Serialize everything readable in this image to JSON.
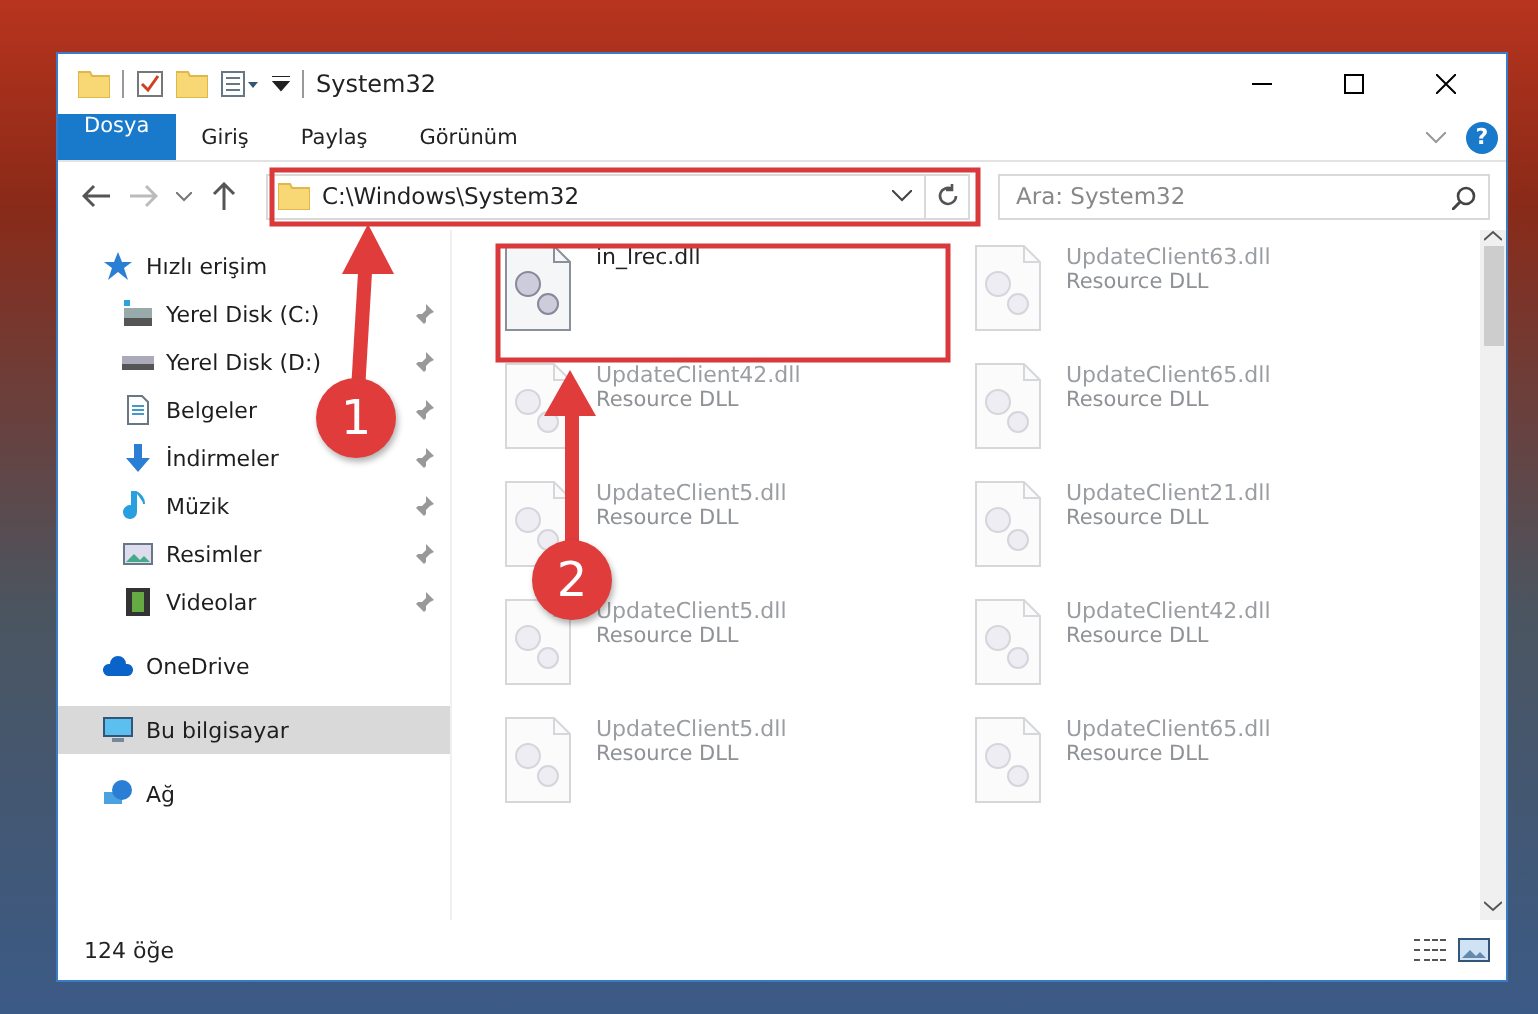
{
  "window": {
    "title": "System32"
  },
  "ribbon": {
    "tabs": [
      {
        "label": "Dosya",
        "kind": "file"
      },
      {
        "label": "Giriş",
        "kind": "tab"
      },
      {
        "label": "Paylaş",
        "kind": "tab"
      },
      {
        "label": "Görünüm",
        "kind": "tab"
      }
    ],
    "help": "?"
  },
  "address": {
    "path": "C:\\Windows\\System32"
  },
  "search": {
    "placeholder": "Ara: System32"
  },
  "nav": [
    {
      "label": "Hızlı erişim",
      "kind": "star",
      "selected": false,
      "children": [
        {
          "label": "Yerel Disk (C:)",
          "kind": "drive-c",
          "pinned": true,
          "selected": false
        },
        {
          "label": "Yerel Disk (D:)",
          "kind": "drive",
          "pinned": true,
          "selected": false
        },
        {
          "label": "Belgeler",
          "kind": "documents",
          "pinned": true,
          "selected": false
        },
        {
          "label": "İndirmeler",
          "kind": "downloads",
          "pinned": true,
          "selected": false
        },
        {
          "label": "Müzik",
          "kind": "music",
          "pinned": true,
          "selected": false
        },
        {
          "label": "Resimler",
          "kind": "pictures",
          "pinned": true,
          "selected": false
        },
        {
          "label": "Videolar",
          "kind": "videos",
          "pinned": true,
          "selected": false
        }
      ]
    },
    {
      "label": "OneDrive",
      "kind": "cloud",
      "selected": false
    },
    {
      "label": "Bu bilgisayar",
      "kind": "computer",
      "selected": true
    },
    {
      "label": "Ağ",
      "kind": "network",
      "selected": false
    }
  ],
  "files": [
    {
      "name": "in_lrec.dll",
      "faded": false
    },
    {
      "name": "UpdateClient63.dll",
      "type": "Resource DLL",
      "faded": true
    },
    {
      "name": "UpdateClient42.dll",
      "type": "Resource DLL",
      "faded": true
    },
    {
      "name": "UpdateClient65.dll",
      "type": "Resource DLL",
      "faded": true
    },
    {
      "name": "UpdateClient5.dll",
      "type": "Resource DLL",
      "faded": true
    },
    {
      "name": "UpdateClient21.dll",
      "type": "Resource DLL",
      "faded": true
    },
    {
      "name": "UpdateClient5.dll",
      "type": "Resource DLL",
      "faded": true
    },
    {
      "name": "UpdateClient42.dll",
      "type": "Resource DLL",
      "faded": true
    },
    {
      "name": "UpdateClient5.dll",
      "type": "Resource DLL",
      "faded": true
    },
    {
      "name": "UpdateClient65.dll",
      "type": "Resource DLL",
      "faded": true
    }
  ],
  "status_bar": {
    "count": "124 öğe"
  },
  "annotations": [
    {
      "label": "1"
    },
    {
      "label": "2"
    }
  ]
}
